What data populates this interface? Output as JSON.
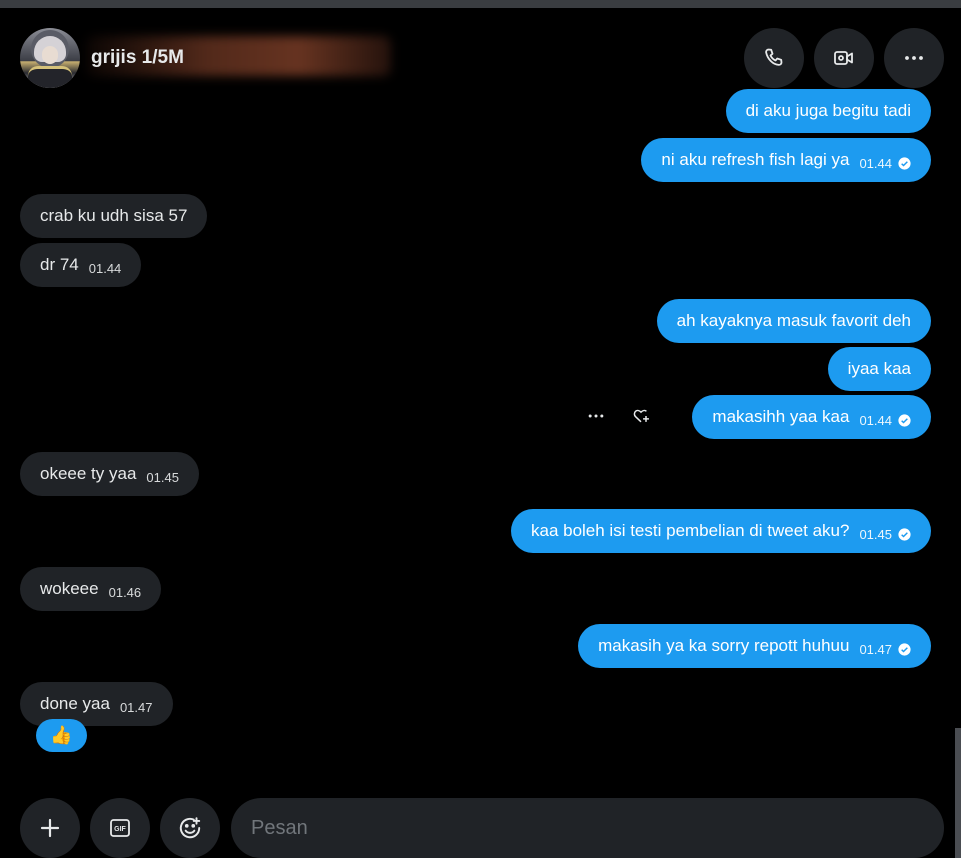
{
  "header": {
    "username": "grijis 1/5M",
    "buttons": [
      {
        "name": "call-button",
        "icon": "phone-icon"
      },
      {
        "name": "video-button",
        "icon": "video-camera-icon"
      },
      {
        "name": "more-button",
        "icon": "more-horizontal-icon"
      }
    ]
  },
  "messages": [
    {
      "dir": "out",
      "text": "di aku juga begitu tadi",
      "time": "",
      "read": false
    },
    {
      "dir": "out",
      "text": "ni aku refresh fish lagi ya",
      "time": "01.44",
      "read": true
    },
    {
      "dir": "in",
      "text": "crab ku udh sisa 57",
      "time": ""
    },
    {
      "dir": "in",
      "text": "dr 74",
      "time": "01.44"
    },
    {
      "dir": "out",
      "text": "ah kayaknya masuk favorit deh",
      "time": "",
      "read": false
    },
    {
      "dir": "out",
      "text": "iyaa kaa",
      "time": "",
      "read": false
    },
    {
      "dir": "out",
      "text": "makasihh yaa kaa",
      "time": "01.44",
      "read": true
    },
    {
      "dir": "in",
      "text": "okeee ty yaa",
      "time": "01.45"
    },
    {
      "dir": "out",
      "text": "kaa boleh isi testi pembelian di tweet aku?",
      "time": "01.45",
      "read": true
    },
    {
      "dir": "in",
      "text": "wokeee",
      "time": "01.46"
    },
    {
      "dir": "out",
      "text": "makasih ya ka sorry repott huhuu",
      "time": "01.47",
      "read": true
    },
    {
      "dir": "in",
      "text": "done yaa",
      "time": "01.47"
    }
  ],
  "reaction": {
    "emoji": "👍"
  },
  "composer": {
    "placeholder": "Pesan",
    "buttons": [
      {
        "name": "add-media-button",
        "icon": "plus-icon"
      },
      {
        "name": "gif-button",
        "icon": "gif-icon"
      },
      {
        "name": "emoji-button",
        "icon": "emoji-icon"
      }
    ]
  },
  "colors": {
    "outgoing": "#1d9bf0",
    "incoming": "#202327",
    "background": "#000000"
  }
}
